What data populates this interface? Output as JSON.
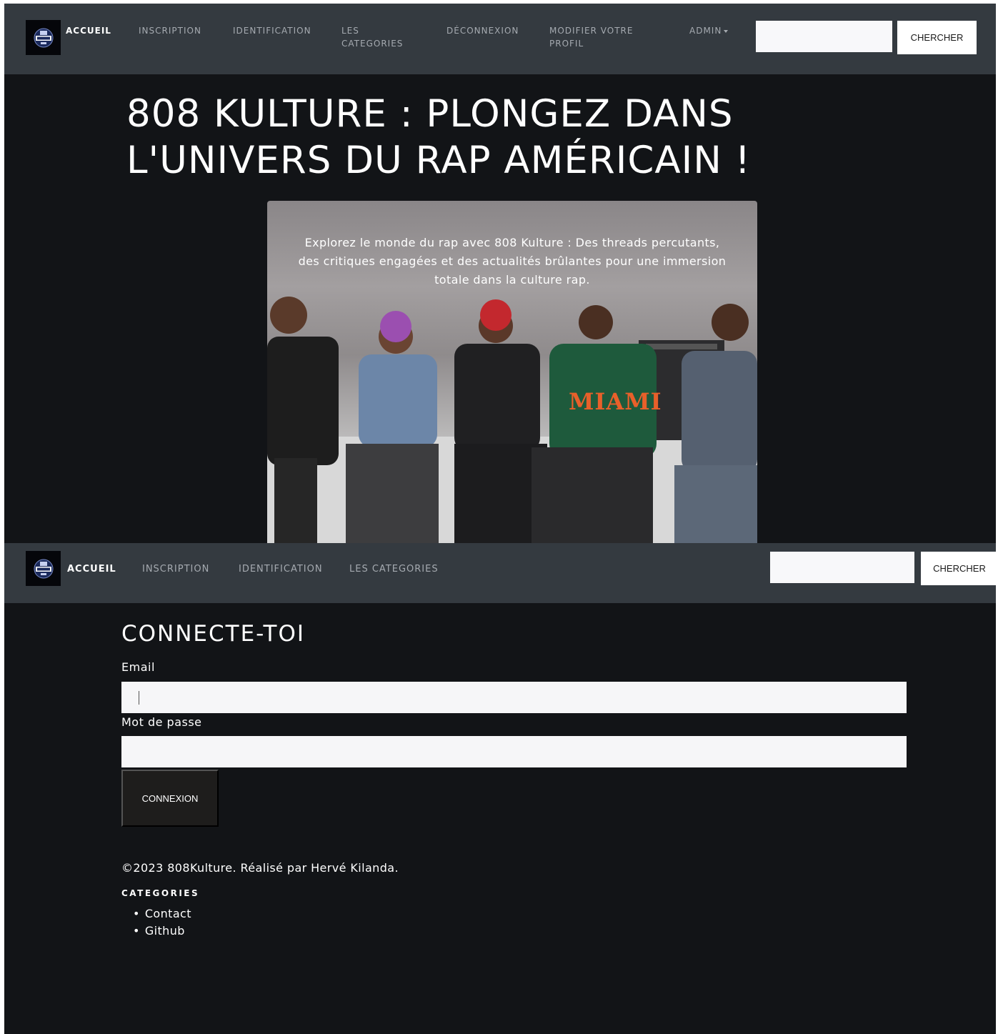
{
  "brand": {
    "logo_icon": "808-kulture-logo-icon"
  },
  "nav_top": {
    "items": [
      {
        "label": "ACCUEIL"
      },
      {
        "label": "INSCRIPTION"
      },
      {
        "label": "IDENTIFICATION"
      },
      {
        "label": "LES\nCATEGORIES"
      },
      {
        "label": "DÉCONNEXION"
      },
      {
        "label": "MODIFIER VOTRE\nPROFIL"
      },
      {
        "label": "ADMIN"
      }
    ],
    "search_button": "CHERCHER",
    "search_value": ""
  },
  "hero": {
    "title": "808 KULTURE : PLONGEZ DANS L'UNIVERS DU RAP AMÉRICAIN !",
    "description": "Explorez le monde du rap avec 808 Kulture : Des threads percutants, des critiques engagées et des actualités brûlantes pour une immersion totale dans la culture rap.",
    "image_text": "MIAMI"
  },
  "nav_bottom": {
    "items": [
      {
        "label": "ACCUEIL"
      },
      {
        "label": "INSCRIPTION"
      },
      {
        "label": "IDENTIFICATION"
      },
      {
        "label": "LES CATEGORIES"
      }
    ],
    "search_button": "CHERCHER",
    "search_value": ""
  },
  "login": {
    "title": "CONNECTE-TOI",
    "email_label": "Email",
    "email_value": "",
    "password_label": "Mot de passe",
    "password_value": "",
    "submit_label": "CONNEXION"
  },
  "footer": {
    "copyright": "©2023 808Kulture. Réalisé par Hervé Kilanda.",
    "heading": "CATEGORIES",
    "links": [
      "Contact",
      "Github"
    ]
  }
}
